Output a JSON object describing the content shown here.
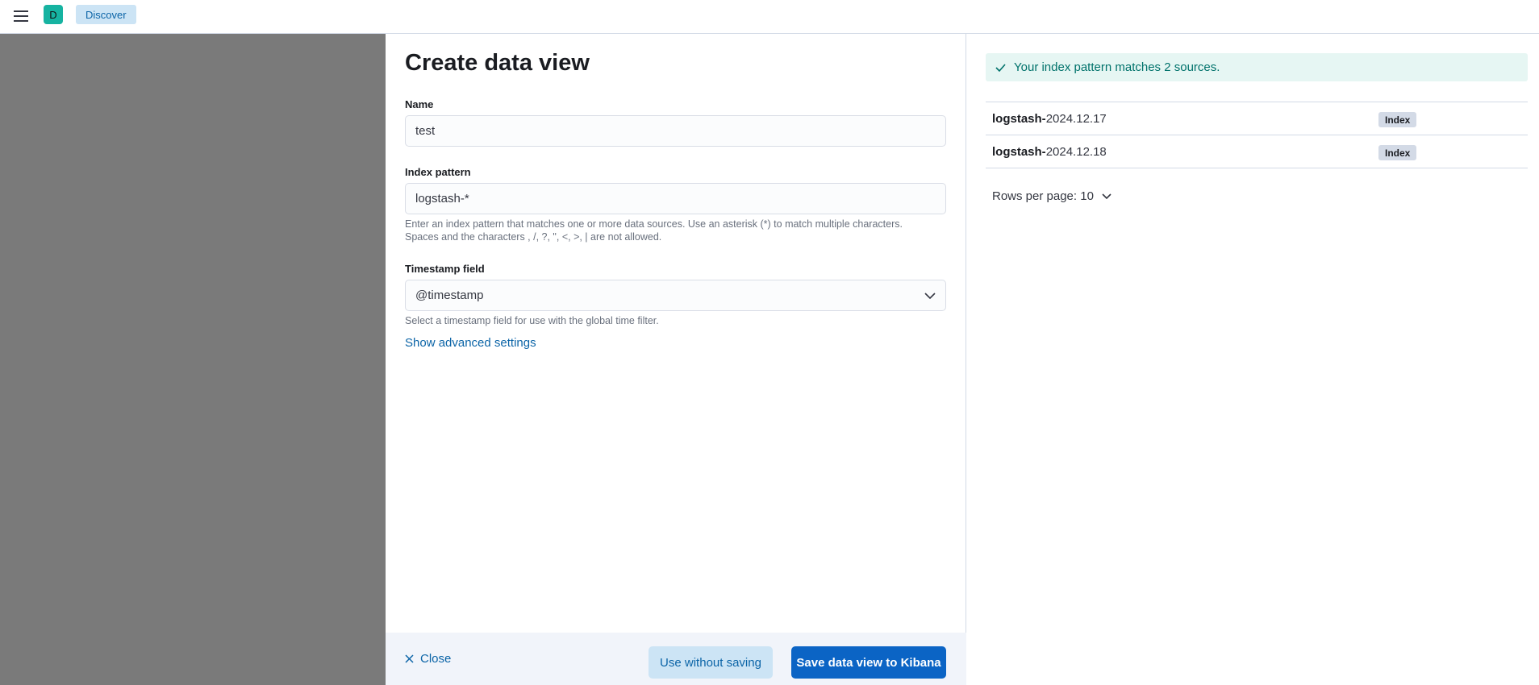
{
  "header": {
    "avatar_initial": "D",
    "breadcrumb": "Discover"
  },
  "form": {
    "title": "Create data view",
    "name_label": "Name",
    "name_value": "test",
    "index_label": "Index pattern",
    "index_value": "logstash-*",
    "index_help_line1": "Enter an index pattern that matches one or more data sources. Use an asterisk (*) to match multiple characters.",
    "index_help_line2": "Spaces and the characters , /, ?, \", <, >, | are not allowed.",
    "timestamp_label": "Timestamp field",
    "timestamp_value": "@timestamp",
    "timestamp_help": "Select a timestamp field for use with the global time filter.",
    "advanced_link": "Show advanced settings"
  },
  "footer": {
    "close_label": "Close",
    "use_without_saving_label": "Use without saving",
    "save_label": "Save data view to Kibana"
  },
  "preview": {
    "callout": "Your index pattern matches 2 sources.",
    "rows": [
      {
        "prefix": "logstash-",
        "suffix": "2024.12.17",
        "badge": "Index"
      },
      {
        "prefix": "logstash-",
        "suffix": "2024.12.18",
        "badge": "Index"
      }
    ],
    "rows_per_page": "Rows per page: 10"
  },
  "colors": {
    "accent": "#0b64c5",
    "success": "#00726b",
    "overlay": "#7a7a7a"
  }
}
